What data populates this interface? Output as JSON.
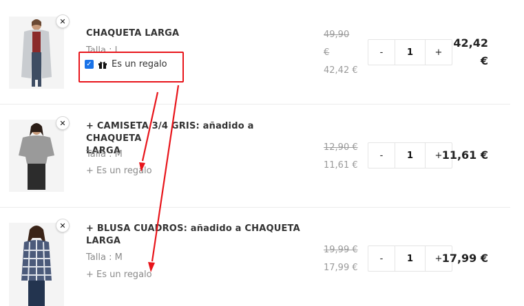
{
  "cart": {
    "items": [
      {
        "name": "CHAQUETA LARGA",
        "size_text": "Talla : L",
        "gift_label": "Es un regalo",
        "gift_checked": true,
        "price_old": "49,90",
        "price_old_currency": "€",
        "price_new": "42,42 €",
        "quantity": "1",
        "total_line1": "42,42",
        "total_line2": "€"
      },
      {
        "name_line1": "+ CAMISETA 3/4 GRIS: añadido a CHAQUETA",
        "name_line2": "LARGA",
        "size_text": "Talla : M",
        "gift_label": "+ Es un regalo",
        "price_old": "12,90 €",
        "price_new": "11,61 €",
        "quantity": "1",
        "total": "11,61 €"
      },
      {
        "name_line1": "+ BLUSA CUADROS: añadido a CHAQUETA",
        "name_line2": "LARGA",
        "size_text": "Talla : M",
        "gift_label": "+ Es un regalo",
        "price_old": "19,99 €",
        "price_new": "17,99 €",
        "quantity": "1",
        "total": "17,99 €"
      }
    ],
    "qty_minus": "-",
    "qty_plus": "+",
    "remove_symbol": "✕"
  },
  "annotation_color": "#e8141a",
  "checkbox_color": "#1a73e8"
}
